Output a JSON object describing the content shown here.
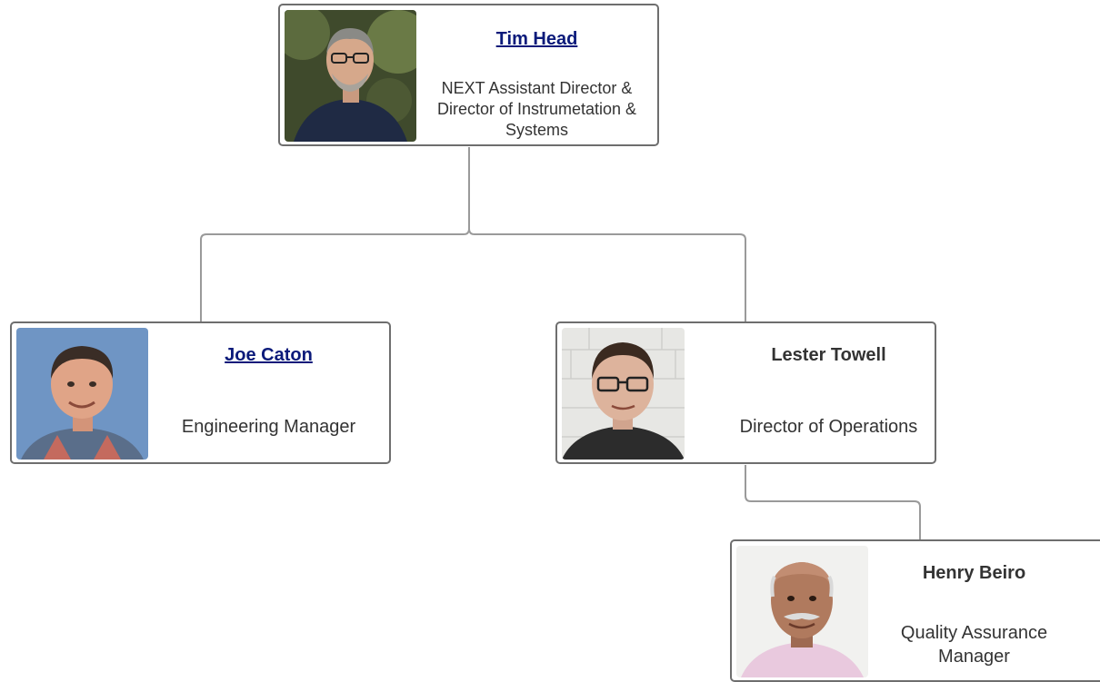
{
  "chart": {
    "nodes": [
      {
        "id": "tim",
        "name": "Tim Head",
        "link": true,
        "title": "NEXT Assistant Director & Director of Instrumetation & Systems",
        "photo": "tim-head-photo"
      },
      {
        "id": "joe",
        "name": "Joe Caton",
        "link": true,
        "title": "Engineering Manager",
        "photo": "joe-caton-photo"
      },
      {
        "id": "lester",
        "name": "Lester Towell",
        "link": false,
        "title": "Director of Operations",
        "photo": "lester-towell-photo"
      },
      {
        "id": "henry",
        "name": "Henry Beiro",
        "link": false,
        "title": "Quality Assurance Manager",
        "photo": "henry-beiro-photo"
      }
    ],
    "edges": [
      {
        "from": "tim",
        "to": "joe"
      },
      {
        "from": "tim",
        "to": "lester"
      },
      {
        "from": "lester",
        "to": "henry"
      }
    ]
  },
  "colors": {
    "connector": "#9a9a9a",
    "card_border": "#6e6e6e",
    "link_text": "#0b1a7a",
    "body_text": "#333333"
  }
}
